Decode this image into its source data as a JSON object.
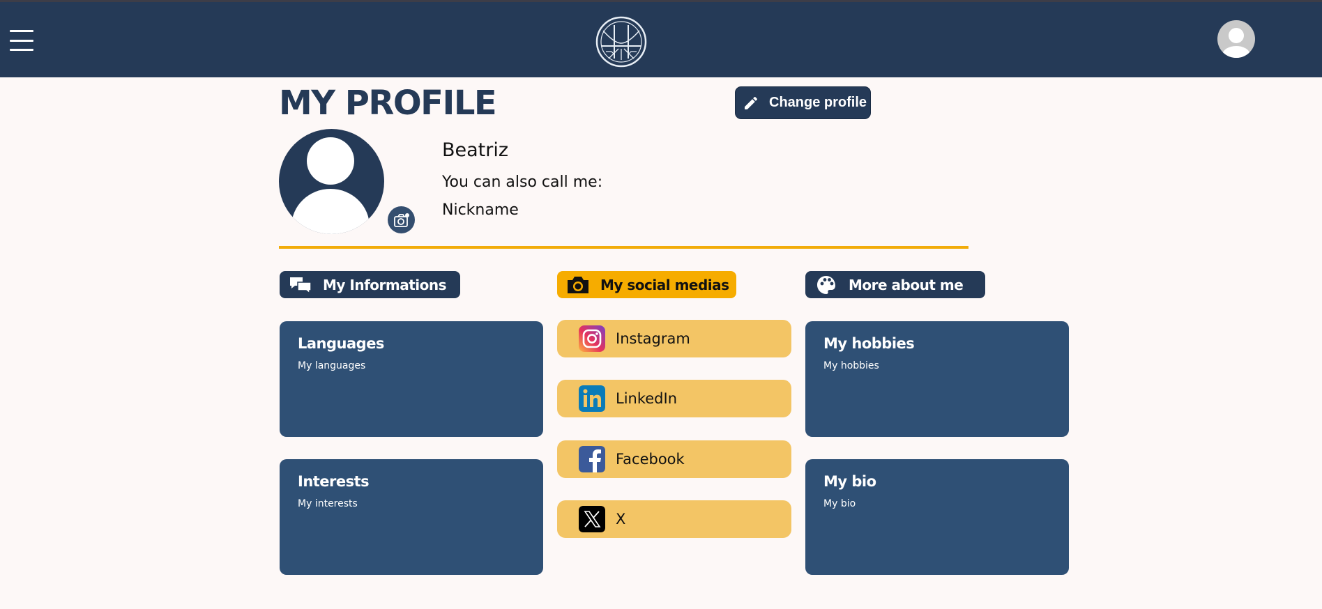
{
  "page": {
    "title": "MY PROFILE",
    "change_profile_label": "Change profile"
  },
  "profile": {
    "name": "Beatriz",
    "call_me_label": "You can also call me:",
    "nickname": "Nickname"
  },
  "sections": {
    "informations": "My Informations",
    "social": "My social medias",
    "more": "More about me"
  },
  "cards": {
    "languages": {
      "title": "Languages",
      "text": "My languages"
    },
    "interests": {
      "title": "Interests",
      "text": "My interests"
    },
    "hobbies": {
      "title": "My hobbies",
      "text": "My hobbies"
    },
    "bio": {
      "title": "My bio",
      "text": "My bio"
    }
  },
  "socials": [
    {
      "label": "Instagram",
      "icon": "instagram-icon"
    },
    {
      "label": "LinkedIn",
      "icon": "linkedin-icon"
    },
    {
      "label": "Facebook",
      "icon": "facebook-icon"
    },
    {
      "label": "X",
      "icon": "x-icon"
    }
  ],
  "colors": {
    "navy": "#253a57",
    "card_blue": "#2f5075",
    "accent_yellow": "#f6ac00",
    "social_yellow": "#f3c565",
    "background": "#fdf8f7"
  }
}
